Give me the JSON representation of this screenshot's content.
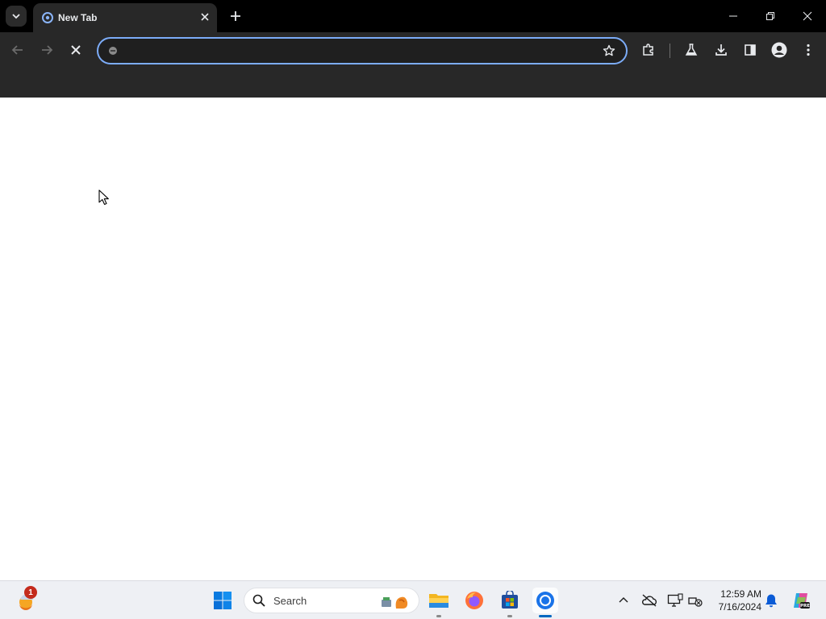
{
  "browser": {
    "tab": {
      "title": "New Tab"
    },
    "omnibox": {
      "value": "",
      "placeholder": ""
    }
  },
  "taskbar": {
    "search_label": "Search",
    "weather_badge": "1",
    "clock": {
      "time": "12:59 AM",
      "date": "7/16/2024"
    }
  },
  "colors": {
    "tabstrip": "#000000",
    "toolbar": "#282828",
    "omnibox_focus_ring": "#7cacf8",
    "taskbar": "#eef0f4",
    "accent_blue": "#0067c0"
  },
  "icons": {
    "tabstrip": [
      "tab-search-icon",
      "tab-favicon",
      "tab-close-icon",
      "new-tab-icon",
      "minimize-icon",
      "restore-icon",
      "window-close-icon"
    ],
    "toolbar": [
      "back-arrow-icon",
      "forward-arrow-icon",
      "stop-loading-icon",
      "site-info-icon",
      "bookmark-star-icon",
      "extensions-icon",
      "labs-flask-icon",
      "downloads-icon",
      "side-panel-icon",
      "profile-icon",
      "menu-dots-icon"
    ],
    "taskbar": [
      "weather-icon",
      "start-icon",
      "search-icon",
      "search-highlight-icon",
      "file-explorer-icon",
      "firefox-icon",
      "store-icon",
      "chrome-icon",
      "tray-chevron-icon",
      "onedrive-icon",
      "display-icon",
      "network-icon",
      "notification-bell-icon",
      "copilot-icon"
    ]
  }
}
